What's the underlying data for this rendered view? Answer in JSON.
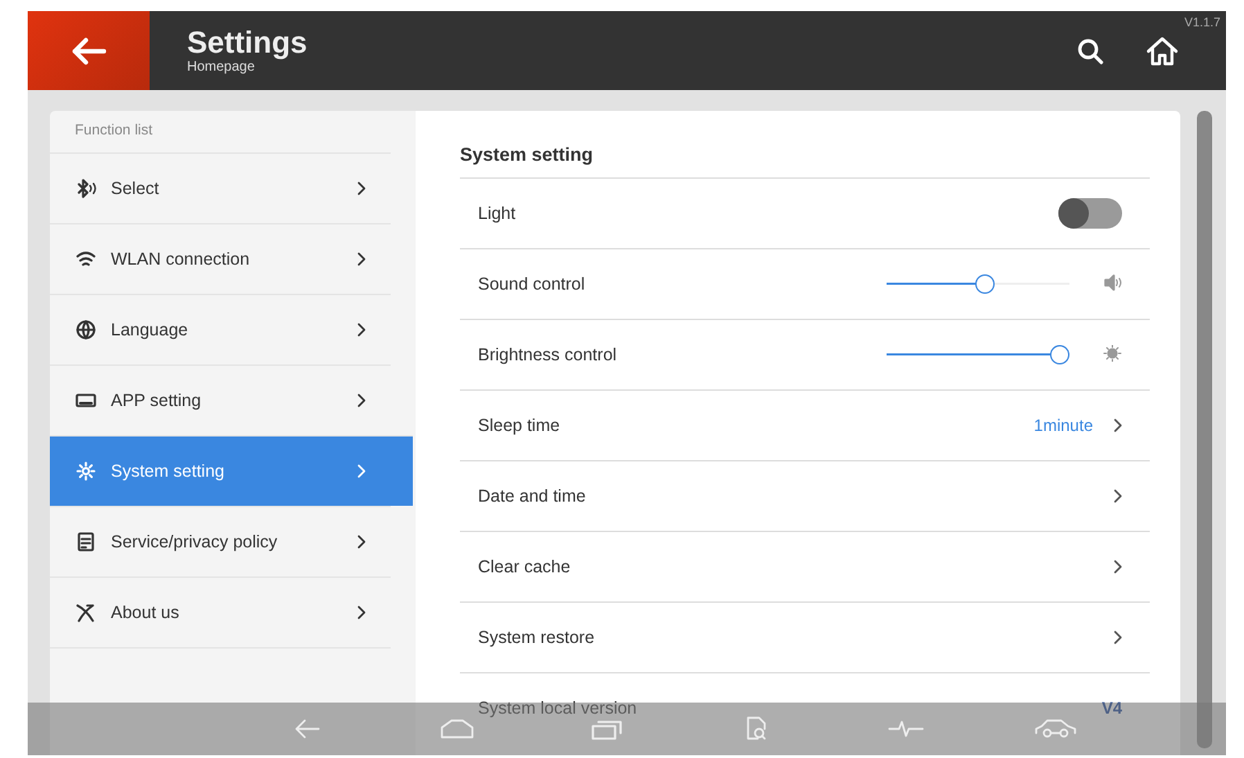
{
  "header": {
    "title": "Settings",
    "subtitle": "Homepage",
    "version": "V1.1.7"
  },
  "sidebar": {
    "heading": "Function list",
    "items": [
      {
        "label": "Select",
        "selected": false
      },
      {
        "label": "WLAN connection",
        "selected": false
      },
      {
        "label": "Language",
        "selected": false
      },
      {
        "label": "APP setting",
        "selected": false
      },
      {
        "label": "System setting",
        "selected": true
      },
      {
        "label": "Service/privacy policy",
        "selected": false
      },
      {
        "label": "About us",
        "selected": false
      }
    ]
  },
  "panel": {
    "title": "System setting",
    "rows": [
      {
        "kind": "toggle",
        "label": "Light",
        "on": false
      },
      {
        "kind": "slider",
        "label": "Sound control",
        "level": 0.54
      },
      {
        "kind": "slider",
        "label": "Brightness control",
        "level": 1.0
      },
      {
        "kind": "link",
        "label": "Sleep time",
        "value": "1minute"
      },
      {
        "kind": "link",
        "label": "Date and time"
      },
      {
        "kind": "link",
        "label": "Clear cache"
      },
      {
        "kind": "link",
        "label": "System restore"
      },
      {
        "kind": "info",
        "label": "System local version",
        "value": "V4"
      }
    ]
  }
}
